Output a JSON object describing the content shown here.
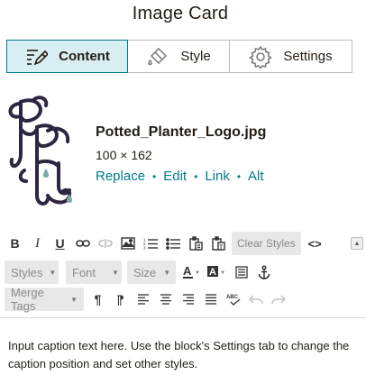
{
  "title": "Image Card",
  "tabs": [
    {
      "label": "Content",
      "icon": "content-edit-icon",
      "active": true
    },
    {
      "label": "Style",
      "icon": "paint-bucket-icon",
      "active": false
    },
    {
      "label": "Settings",
      "icon": "gear-icon",
      "active": false
    }
  ],
  "image": {
    "filename": "Potted_Planter_Logo.jpg",
    "dimensions": "100 × 162",
    "actions": {
      "replace": "Replace",
      "edit": "Edit",
      "link": "Link",
      "alt": "Alt"
    }
  },
  "toolbar": {
    "bold": "B",
    "italic": "I",
    "underline": "U",
    "clear_styles": "Clear Styles",
    "source": "<>",
    "styles": "Styles",
    "font": "Font",
    "size": "Size",
    "merge_tags": "Merge Tags"
  },
  "caption": "Input caption text here. Use the block's Settings tab to change the caption position and set other styles.",
  "colors": {
    "accent": "#007c89",
    "active_tab_bg": "#d9eef2",
    "text": "#241c15",
    "logo_ink": "#2e2540",
    "logo_drop": "#7fa7a7"
  }
}
